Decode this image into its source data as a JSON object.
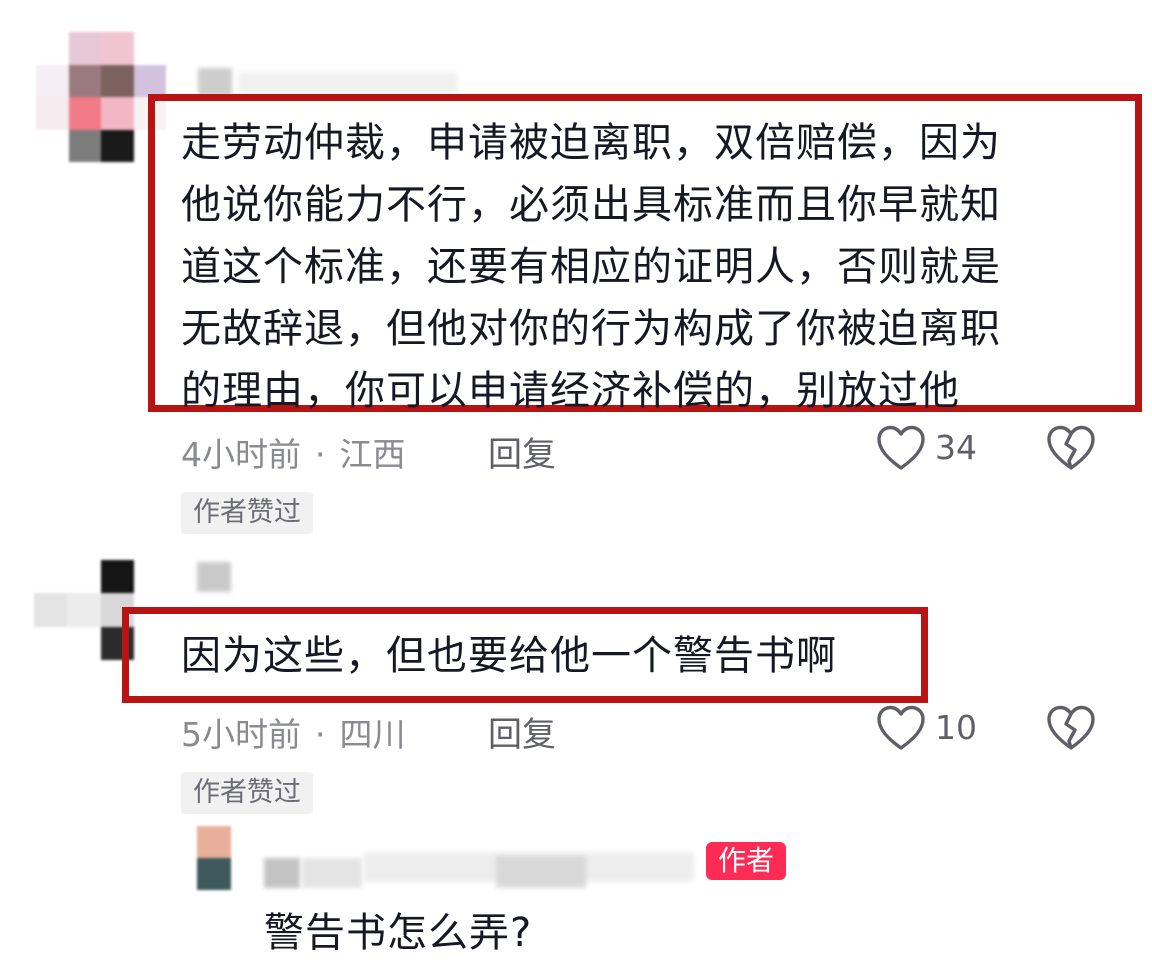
{
  "comments": [
    {
      "text": "走劳动仲裁，申请被迫离职，双倍赔偿，因为\n他说你能力不行，必须出具标准而且你早就知\n道这个标准，还要有相应的证明人，否则就是\n无故辞退，但他对你的行为构成了你被迫离职\n的理由，你可以申请经济补偿的，别放过他",
      "time": "4小时前",
      "location": "江西",
      "reply_label": "回复",
      "likes": "34",
      "liked_tag": "作者赞过"
    },
    {
      "text": "因为这些，但也要给他一个警告书啊",
      "time": "5小时前",
      "location": "四川",
      "reply_label": "回复",
      "likes": "10",
      "liked_tag": "作者赞过"
    }
  ],
  "reply": {
    "badge": "作者",
    "text": "警告书怎么弄?"
  },
  "separator": "·",
  "colors": {
    "highlight": "#b81414",
    "author_badge": "#fe2c55",
    "meta_text": "#8a8b91"
  },
  "icons": [
    "heart-outline-icon",
    "broken-heart-icon"
  ]
}
